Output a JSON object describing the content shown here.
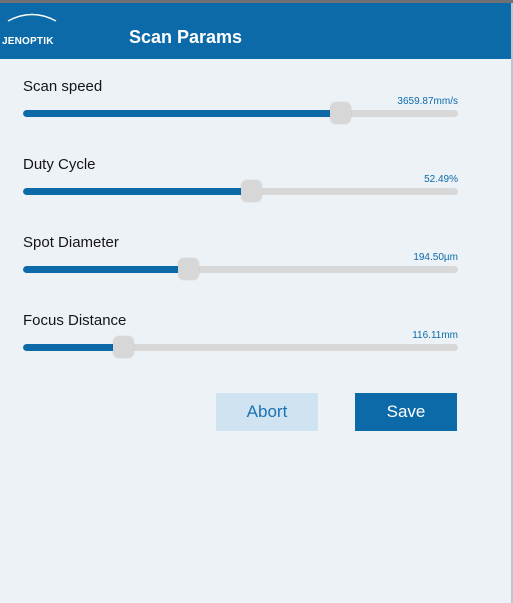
{
  "header": {
    "logo_text": "JENOPTIK",
    "title": "Scan Params"
  },
  "sliders": [
    {
      "label": "Scan speed",
      "value_text": "3659.87mm/s",
      "fraction": 0.73
    },
    {
      "label": "Duty Cycle",
      "value_text": "52.49%",
      "fraction": 0.5249
    },
    {
      "label": "Spot Diameter",
      "value_text": "194.50µm",
      "fraction": 0.38
    },
    {
      "label": "Focus Distance",
      "value_text": "116.11mm",
      "fraction": 0.23
    }
  ],
  "actions": {
    "abort_label": "Abort",
    "save_label": "Save"
  },
  "colors": {
    "header": "#0c6aa9",
    "slider_fill": "#0c6aa9",
    "slider_track": "#d8d8d8",
    "background": "#edf2f7",
    "abort_background": "#cfe3f0",
    "save_background": "#0c6aa9"
  }
}
